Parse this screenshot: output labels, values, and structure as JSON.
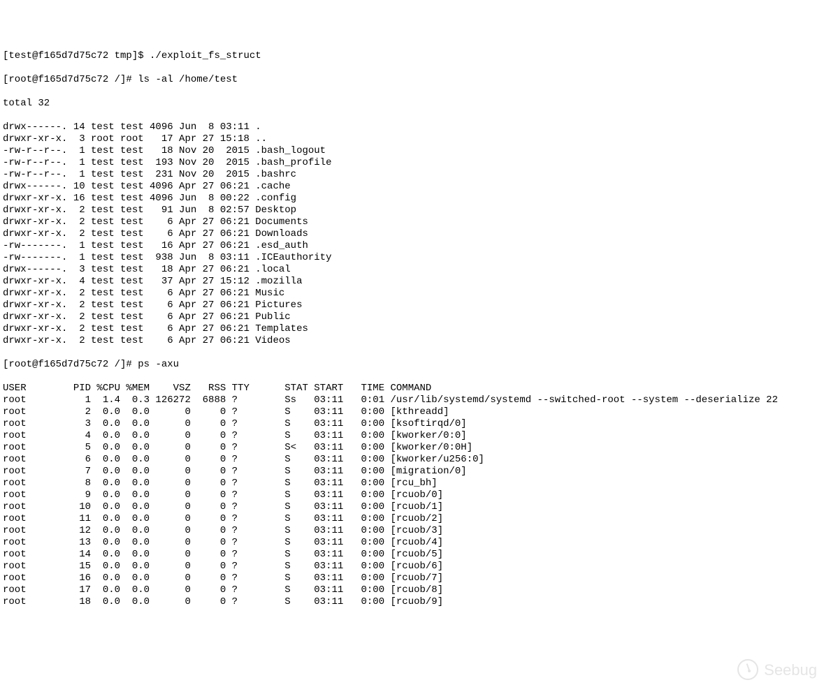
{
  "prompts": {
    "test_prompt": "[test@f165d7d75c72 tmp]$ ",
    "root_prompt": "[root@f165d7d75c72 /]# ",
    "cmd_exploit": "./exploit_fs_struct",
    "cmd_ls": "ls -al /home/test",
    "cmd_ps": "ps -axu"
  },
  "ls": {
    "total": "total 32",
    "rows": [
      {
        "perm": "drwx------.",
        "links": "14",
        "owner": "test",
        "group": "test",
        "size": "4096",
        "month": "Jun",
        "day": " 8",
        "time": "03:11",
        "name": "."
      },
      {
        "perm": "drwxr-xr-x.",
        "links": " 3",
        "owner": "root",
        "group": "root",
        "size": "  17",
        "month": "Apr",
        "day": "27",
        "time": "15:18",
        "name": ".."
      },
      {
        "perm": "-rw-r--r--.",
        "links": " 1",
        "owner": "test",
        "group": "test",
        "size": "  18",
        "month": "Nov",
        "day": "20",
        "time": " 2015",
        "name": ".bash_logout"
      },
      {
        "perm": "-rw-r--r--.",
        "links": " 1",
        "owner": "test",
        "group": "test",
        "size": " 193",
        "month": "Nov",
        "day": "20",
        "time": " 2015",
        "name": ".bash_profile"
      },
      {
        "perm": "-rw-r--r--.",
        "links": " 1",
        "owner": "test",
        "group": "test",
        "size": " 231",
        "month": "Nov",
        "day": "20",
        "time": " 2015",
        "name": ".bashrc"
      },
      {
        "perm": "drwx------.",
        "links": "10",
        "owner": "test",
        "group": "test",
        "size": "4096",
        "month": "Apr",
        "day": "27",
        "time": "06:21",
        "name": ".cache"
      },
      {
        "perm": "drwxr-xr-x.",
        "links": "16",
        "owner": "test",
        "group": "test",
        "size": "4096",
        "month": "Jun",
        "day": " 8",
        "time": "00:22",
        "name": ".config"
      },
      {
        "perm": "drwxr-xr-x.",
        "links": " 2",
        "owner": "test",
        "group": "test",
        "size": "  91",
        "month": "Jun",
        "day": " 8",
        "time": "02:57",
        "name": "Desktop"
      },
      {
        "perm": "drwxr-xr-x.",
        "links": " 2",
        "owner": "test",
        "group": "test",
        "size": "   6",
        "month": "Apr",
        "day": "27",
        "time": "06:21",
        "name": "Documents"
      },
      {
        "perm": "drwxr-xr-x.",
        "links": " 2",
        "owner": "test",
        "group": "test",
        "size": "   6",
        "month": "Apr",
        "day": "27",
        "time": "06:21",
        "name": "Downloads"
      },
      {
        "perm": "-rw-------.",
        "links": " 1",
        "owner": "test",
        "group": "test",
        "size": "  16",
        "month": "Apr",
        "day": "27",
        "time": "06:21",
        "name": ".esd_auth"
      },
      {
        "perm": "-rw-------.",
        "links": " 1",
        "owner": "test",
        "group": "test",
        "size": " 938",
        "month": "Jun",
        "day": " 8",
        "time": "03:11",
        "name": ".ICEauthority"
      },
      {
        "perm": "drwx------.",
        "links": " 3",
        "owner": "test",
        "group": "test",
        "size": "  18",
        "month": "Apr",
        "day": "27",
        "time": "06:21",
        "name": ".local"
      },
      {
        "perm": "drwxr-xr-x.",
        "links": " 4",
        "owner": "test",
        "group": "test",
        "size": "  37",
        "month": "Apr",
        "day": "27",
        "time": "15:12",
        "name": ".mozilla"
      },
      {
        "perm": "drwxr-xr-x.",
        "links": " 2",
        "owner": "test",
        "group": "test",
        "size": "   6",
        "month": "Apr",
        "day": "27",
        "time": "06:21",
        "name": "Music"
      },
      {
        "perm": "drwxr-xr-x.",
        "links": " 2",
        "owner": "test",
        "group": "test",
        "size": "   6",
        "month": "Apr",
        "day": "27",
        "time": "06:21",
        "name": "Pictures"
      },
      {
        "perm": "drwxr-xr-x.",
        "links": " 2",
        "owner": "test",
        "group": "test",
        "size": "   6",
        "month": "Apr",
        "day": "27",
        "time": "06:21",
        "name": "Public"
      },
      {
        "perm": "drwxr-xr-x.",
        "links": " 2",
        "owner": "test",
        "group": "test",
        "size": "   6",
        "month": "Apr",
        "day": "27",
        "time": "06:21",
        "name": "Templates"
      },
      {
        "perm": "drwxr-xr-x.",
        "links": " 2",
        "owner": "test",
        "group": "test",
        "size": "   6",
        "month": "Apr",
        "day": "27",
        "time": "06:21",
        "name": "Videos"
      }
    ]
  },
  "ps": {
    "header": {
      "user": "USER",
      "pid": "PID",
      "cpu": "%CPU",
      "mem": "%MEM",
      "vsz": "VSZ",
      "rss": "RSS",
      "tty": "TTY",
      "stat": "STAT",
      "start": "START",
      "time": "TIME",
      "command": "COMMAND"
    },
    "rows": [
      {
        "user": "root",
        "pid": "1",
        "cpu": "1.4",
        "mem": "0.3",
        "vsz": "126272",
        "rss": "6888",
        "tty": "?",
        "stat": "Ss",
        "start": "03:11",
        "time": "0:01",
        "command": "/usr/lib/systemd/systemd --switched-root --system --deserialize 22"
      },
      {
        "user": "root",
        "pid": "2",
        "cpu": "0.0",
        "mem": "0.0",
        "vsz": "0",
        "rss": "0",
        "tty": "?",
        "stat": "S",
        "start": "03:11",
        "time": "0:00",
        "command": "[kthreadd]"
      },
      {
        "user": "root",
        "pid": "3",
        "cpu": "0.0",
        "mem": "0.0",
        "vsz": "0",
        "rss": "0",
        "tty": "?",
        "stat": "S",
        "start": "03:11",
        "time": "0:00",
        "command": "[ksoftirqd/0]"
      },
      {
        "user": "root",
        "pid": "4",
        "cpu": "0.0",
        "mem": "0.0",
        "vsz": "0",
        "rss": "0",
        "tty": "?",
        "stat": "S",
        "start": "03:11",
        "time": "0:00",
        "command": "[kworker/0:0]"
      },
      {
        "user": "root",
        "pid": "5",
        "cpu": "0.0",
        "mem": "0.0",
        "vsz": "0",
        "rss": "0",
        "tty": "?",
        "stat": "S<",
        "start": "03:11",
        "time": "0:00",
        "command": "[kworker/0:0H]"
      },
      {
        "user": "root",
        "pid": "6",
        "cpu": "0.0",
        "mem": "0.0",
        "vsz": "0",
        "rss": "0",
        "tty": "?",
        "stat": "S",
        "start": "03:11",
        "time": "0:00",
        "command": "[kworker/u256:0]"
      },
      {
        "user": "root",
        "pid": "7",
        "cpu": "0.0",
        "mem": "0.0",
        "vsz": "0",
        "rss": "0",
        "tty": "?",
        "stat": "S",
        "start": "03:11",
        "time": "0:00",
        "command": "[migration/0]"
      },
      {
        "user": "root",
        "pid": "8",
        "cpu": "0.0",
        "mem": "0.0",
        "vsz": "0",
        "rss": "0",
        "tty": "?",
        "stat": "S",
        "start": "03:11",
        "time": "0:00",
        "command": "[rcu_bh]"
      },
      {
        "user": "root",
        "pid": "9",
        "cpu": "0.0",
        "mem": "0.0",
        "vsz": "0",
        "rss": "0",
        "tty": "?",
        "stat": "S",
        "start": "03:11",
        "time": "0:00",
        "command": "[rcuob/0]"
      },
      {
        "user": "root",
        "pid": "10",
        "cpu": "0.0",
        "mem": "0.0",
        "vsz": "0",
        "rss": "0",
        "tty": "?",
        "stat": "S",
        "start": "03:11",
        "time": "0:00",
        "command": "[rcuob/1]"
      },
      {
        "user": "root",
        "pid": "11",
        "cpu": "0.0",
        "mem": "0.0",
        "vsz": "0",
        "rss": "0",
        "tty": "?",
        "stat": "S",
        "start": "03:11",
        "time": "0:00",
        "command": "[rcuob/2]"
      },
      {
        "user": "root",
        "pid": "12",
        "cpu": "0.0",
        "mem": "0.0",
        "vsz": "0",
        "rss": "0",
        "tty": "?",
        "stat": "S",
        "start": "03:11",
        "time": "0:00",
        "command": "[rcuob/3]"
      },
      {
        "user": "root",
        "pid": "13",
        "cpu": "0.0",
        "mem": "0.0",
        "vsz": "0",
        "rss": "0",
        "tty": "?",
        "stat": "S",
        "start": "03:11",
        "time": "0:00",
        "command": "[rcuob/4]"
      },
      {
        "user": "root",
        "pid": "14",
        "cpu": "0.0",
        "mem": "0.0",
        "vsz": "0",
        "rss": "0",
        "tty": "?",
        "stat": "S",
        "start": "03:11",
        "time": "0:00",
        "command": "[rcuob/5]"
      },
      {
        "user": "root",
        "pid": "15",
        "cpu": "0.0",
        "mem": "0.0",
        "vsz": "0",
        "rss": "0",
        "tty": "?",
        "stat": "S",
        "start": "03:11",
        "time": "0:00",
        "command": "[rcuob/6]"
      },
      {
        "user": "root",
        "pid": "16",
        "cpu": "0.0",
        "mem": "0.0",
        "vsz": "0",
        "rss": "0",
        "tty": "?",
        "stat": "S",
        "start": "03:11",
        "time": "0:00",
        "command": "[rcuob/7]"
      },
      {
        "user": "root",
        "pid": "17",
        "cpu": "0.0",
        "mem": "0.0",
        "vsz": "0",
        "rss": "0",
        "tty": "?",
        "stat": "S",
        "start": "03:11",
        "time": "0:00",
        "command": "[rcuob/8]"
      },
      {
        "user": "root",
        "pid": "18",
        "cpu": "0.0",
        "mem": "0.0",
        "vsz": "0",
        "rss": "0",
        "tty": "?",
        "stat": "S",
        "start": "03:11",
        "time": "0:00",
        "command": "[rcuob/9]"
      }
    ]
  },
  "watermark": {
    "text": "Seebug"
  }
}
